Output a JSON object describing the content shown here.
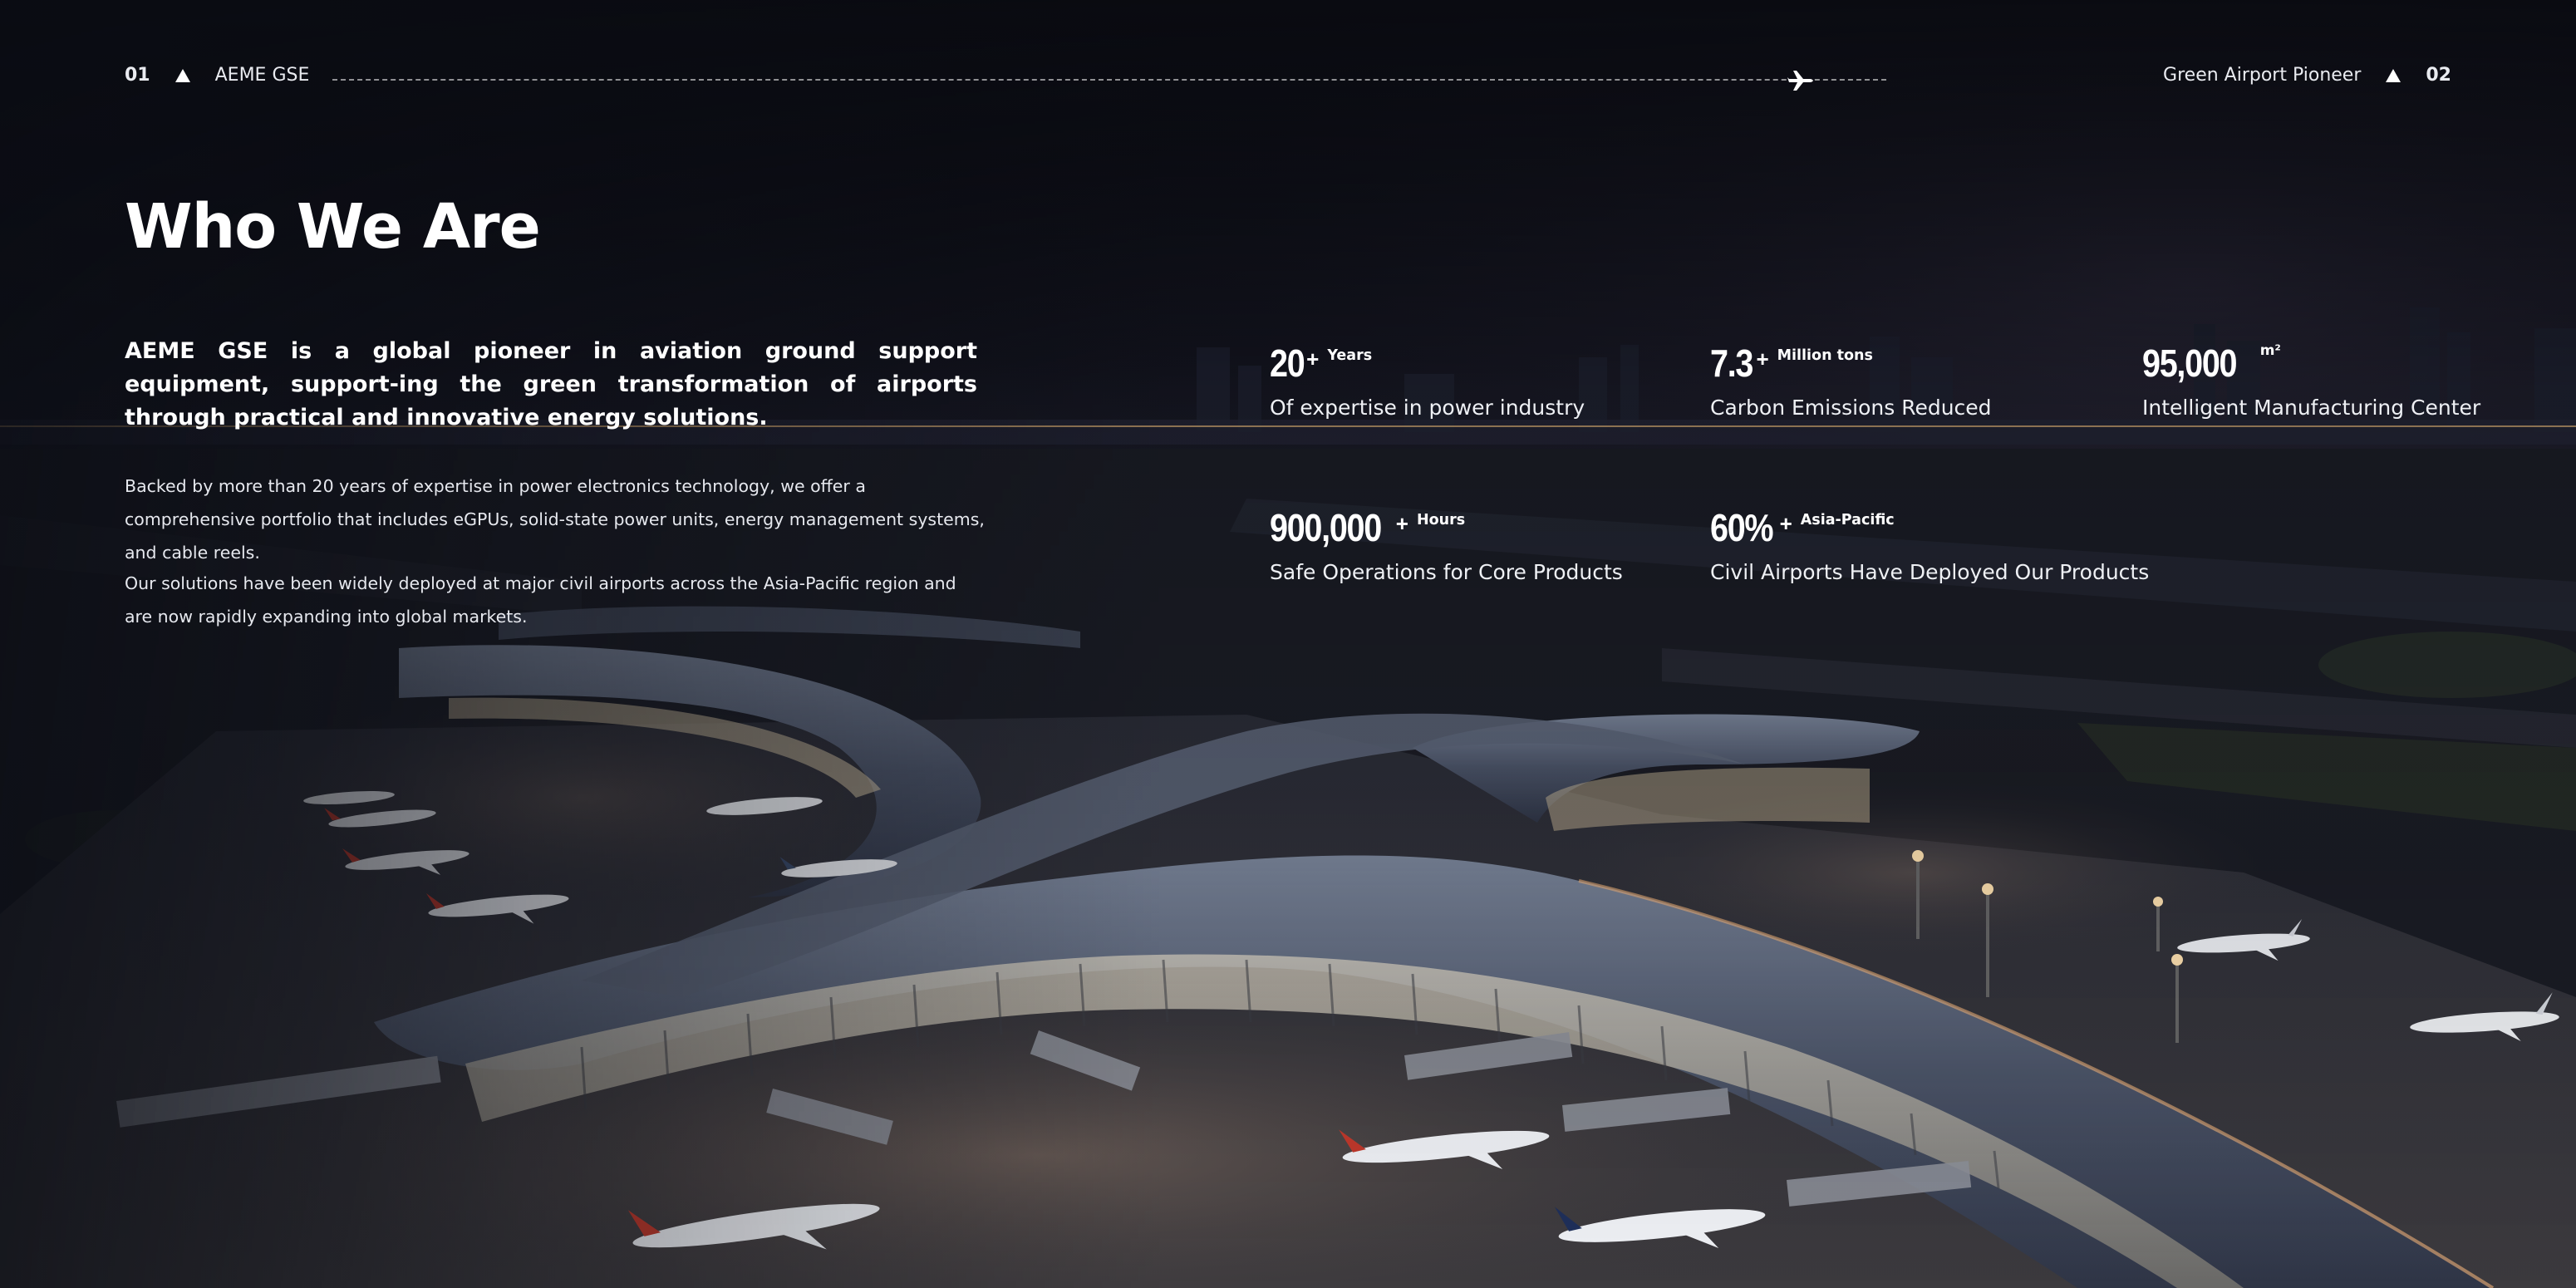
{
  "topbar": {
    "left_number": "01",
    "left_label": "AEME GSE",
    "right_label": "Green Airport Pioneer",
    "right_number": "02",
    "icons": [
      "triangle-icon",
      "airplane-icon",
      "triangle-icon"
    ]
  },
  "title": "Who We Are",
  "lead": "AEME GSE is a global pioneer in aviation ground support equipment, support-ing the green transformation of airports through practical and innovative energy solutions.",
  "paragraphs": [
    "Backed by more than 20 years of expertise in power electronics technology, we offer a comprehensive portfolio that includes eGPUs, solid-state power units, energy management systems, and cable reels.",
    "Our solutions have been widely deployed at major civil airports across the Asia-Pacific region and are now rapidly expanding into global markets."
  ],
  "stats": [
    {
      "number": "20",
      "suffix": "+",
      "unit": "Years",
      "caption": "Of expertise in power industry"
    },
    {
      "number": "7.3",
      "suffix": "+",
      "unit": "Million tons",
      "caption": "Carbon Emissions Reduced"
    },
    {
      "number": "95,000",
      "suffix": "",
      "unit": "m²",
      "caption": "Intelligent Manufacturing Center"
    },
    {
      "number": "900,000",
      "suffix": "+",
      "unit": "Hours",
      "caption": "Safe Operations for Core Products"
    },
    {
      "number": "60%",
      "suffix": "+",
      "unit": "Asia-Pacific",
      "caption": "Civil Airports Have Deployed Our Products"
    }
  ],
  "colors": {
    "background": "#0b0d14",
    "text": "#ffffff",
    "warm_light": "#f2c48f"
  }
}
